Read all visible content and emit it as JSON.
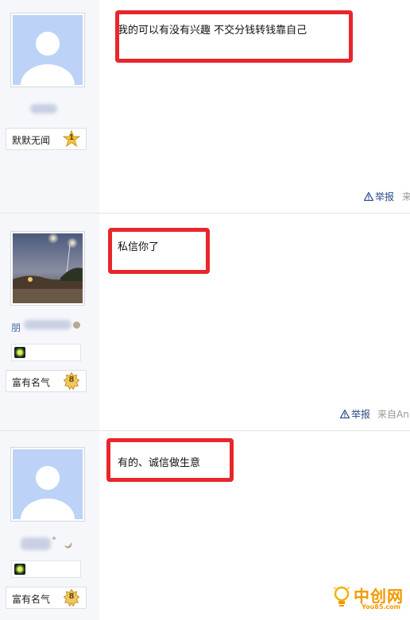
{
  "posts": [
    {
      "user_title": "默默无闻",
      "level": "1",
      "content": "我的可以有没有兴趣 不交分钱转钱靠自己",
      "report_label": "举报",
      "from_label": "来"
    },
    {
      "username_prefix": "朋",
      "user_title": "富有名气",
      "level": "8",
      "content": "私信你了",
      "report_label": "举报",
      "from_label": "来自An"
    },
    {
      "user_title": "富有名气",
      "level": "8",
      "content": "有的、诚信做生意"
    }
  ],
  "watermark": {
    "brand": "中创网",
    "site": "You85.com"
  },
  "colors": {
    "highlight_box": "#e8262b",
    "sidebar_bg": "#f6f7fb",
    "link": "#2a4a8a",
    "watermark": "#f39800"
  }
}
